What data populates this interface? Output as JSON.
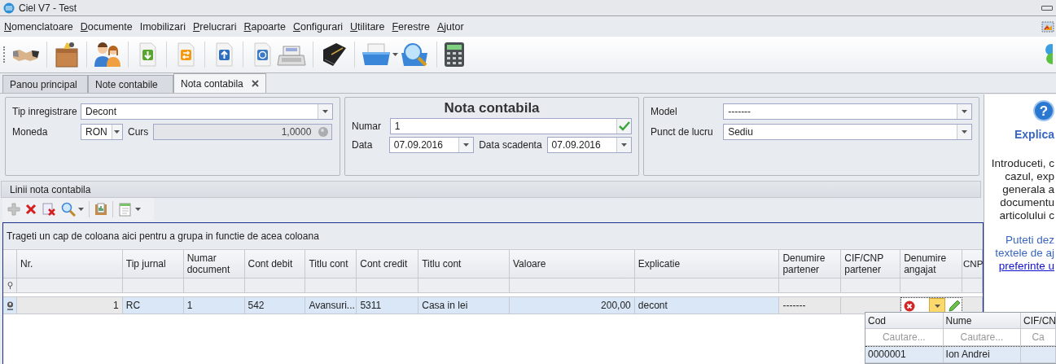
{
  "window": {
    "title": "Ciel V7 - Test"
  },
  "menu": [
    {
      "label": "Nomenclatoare",
      "mnemonic": true
    },
    {
      "label": "Documente",
      "mnemonic": true
    },
    {
      "label": "Imobilizari",
      "mnemonic": false
    },
    {
      "label": "Prelucrari",
      "mnemonic": true
    },
    {
      "label": "Rapoarte",
      "mnemonic": true
    },
    {
      "label": "Configurari",
      "mnemonic": true
    },
    {
      "label": "Utilitare",
      "mnemonic": true
    },
    {
      "label": "Ferestre",
      "mnemonic": true
    },
    {
      "label": "Ajutor",
      "mnemonic": true
    }
  ],
  "tabs": [
    {
      "label": "Panou principal",
      "selected": false,
      "closable": false
    },
    {
      "label": "Note contabile",
      "selected": false,
      "closable": false
    },
    {
      "label": "Nota contabila",
      "selected": true,
      "closable": true
    }
  ],
  "header": {
    "title": "Nota contabila",
    "left": [
      {
        "label": "Tip inregistrare",
        "value": "Decont",
        "kind": "dropdown"
      },
      {
        "label": "Moneda",
        "value": "RON",
        "kind": "dropdown",
        "pair": {
          "label": "Curs",
          "value": "1,0000",
          "kind": "readonly",
          "disabled": true
        }
      }
    ],
    "middle": [
      {
        "label": "Numar",
        "value": "1",
        "kind": "validated"
      },
      {
        "label": "Data",
        "value": "07.09.2016",
        "kind": "dropdown",
        "pair": {
          "label": "Data scadenta",
          "value": "07.09.2016",
          "kind": "dropdown"
        }
      }
    ],
    "right": [
      {
        "label": "Model",
        "value": "-------",
        "kind": "dropdown"
      },
      {
        "label": "Punct de lucru",
        "value": "Sediu",
        "kind": "dropdown"
      }
    ]
  },
  "lines": {
    "title": "Linii nota contabila",
    "group_hint": "Trageti un cap de coloana aici pentru a grupa in functie de acea coloana",
    "columns": [
      {
        "label": "Nr.",
        "kind": "number",
        "readonly": true
      },
      {
        "label": "Tip jurnal",
        "kind": "text",
        "readonly": false
      },
      {
        "label": "Numar document",
        "kind": "text",
        "readonly": false
      },
      {
        "label": "Cont debit",
        "kind": "text",
        "readonly": false
      },
      {
        "label": "Titlu cont",
        "kind": "text",
        "readonly": false
      },
      {
        "label": "Cont credit",
        "kind": "text",
        "readonly": false
      },
      {
        "label": "Titlu cont",
        "kind": "text",
        "readonly": false
      },
      {
        "label": "Valoare",
        "kind": "number",
        "readonly": false
      },
      {
        "label": "Explicatie",
        "kind": "text",
        "readonly": false
      },
      {
        "label": "Denumire partener",
        "kind": "text",
        "readonly": true
      },
      {
        "label": "CIF/CNP partener",
        "kind": "text",
        "readonly": true
      },
      {
        "label": "Denumire angajat",
        "kind": "text",
        "readonly": false
      },
      {
        "label": "CNP",
        "kind": "text",
        "readonly": true
      }
    ],
    "rows": [
      {
        "selected": true,
        "cells": [
          {
            "text": "1"
          },
          {
            "text": "RC"
          },
          {
            "text": "1"
          },
          {
            "text": "542"
          },
          {
            "text": "Avansuri..."
          },
          {
            "text": "5311"
          },
          {
            "text": "Casa in lei"
          },
          {
            "text": "200,00"
          },
          {
            "text": "decont"
          },
          {
            "text": "-------"
          },
          {
            "kind": "empty"
          },
          {
            "kind": "lookup-editor"
          },
          {
            "kind": "empty"
          }
        ]
      }
    ]
  },
  "lookup": {
    "columns": [
      "Cod",
      "Nume",
      "CIF/CN"
    ],
    "filters": [
      "Cautare...",
      "Cautare...",
      "Ca"
    ],
    "rows": [
      {
        "selected": true,
        "cells": [
          "0000001",
          "Ion Andrei"
        ]
      }
    ]
  },
  "help": {
    "icon": "?",
    "title": "Explica",
    "paragraphs": [
      [
        "Introduceti, c",
        "cazul, exp",
        "generala a",
        "documentu",
        "articolului c"
      ],
      [
        "Puteti dez",
        "textele de aj"
      ]
    ],
    "link": "preferinte u"
  }
}
